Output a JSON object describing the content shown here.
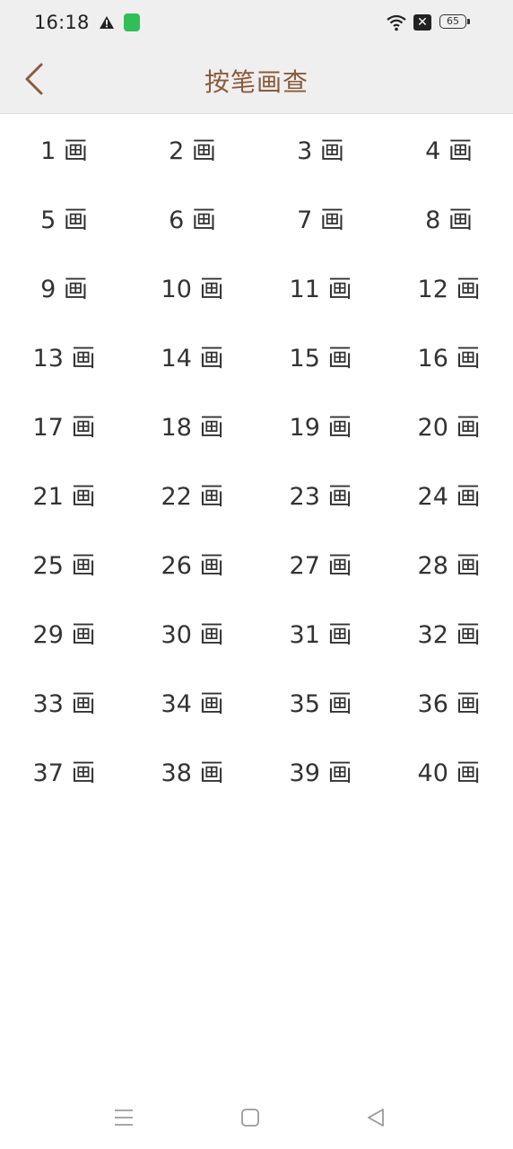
{
  "status_bar": {
    "time": "16:18",
    "battery": "65",
    "icons": [
      "warning-icon",
      "sim-card-icon",
      "wifi-icon",
      "no-sim-icon",
      "battery-icon"
    ],
    "nosim_glyph": "✕"
  },
  "header": {
    "title": "按笔画查",
    "title_color": "#8b5a3c",
    "back_icon": "chevron-left-icon"
  },
  "strokes": [
    "1 画",
    "2 画",
    "3 画",
    "4 画",
    "5 画",
    "6 画",
    "7 画",
    "8 画",
    "9 画",
    "10 画",
    "11 画",
    "12 画",
    "13 画",
    "14 画",
    "15 画",
    "16 画",
    "17 画",
    "18 画",
    "19 画",
    "20 画",
    "21 画",
    "22 画",
    "23 画",
    "24 画",
    "25 画",
    "26 画",
    "27 画",
    "28 画",
    "29 画",
    "30 画",
    "31 画",
    "32 画",
    "33 画",
    "34 画",
    "35 画",
    "36 画",
    "37 画",
    "38 画",
    "39 画",
    "40 画"
  ],
  "system_nav": {
    "icons": [
      "menu-icon",
      "home-icon",
      "back-triangle-icon"
    ]
  }
}
